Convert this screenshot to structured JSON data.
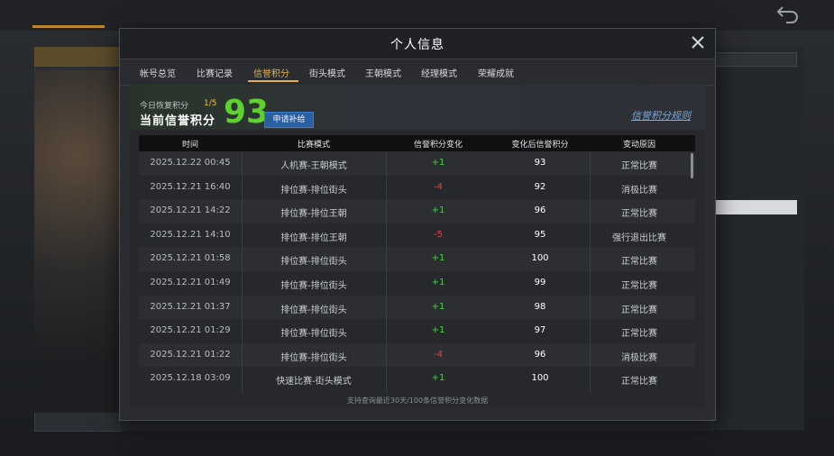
{
  "modal": {
    "title": "个人信息",
    "close_icon": "close-icon"
  },
  "tabs": [
    {
      "label": "帐号总览",
      "active": false
    },
    {
      "label": "比赛记录",
      "active": false
    },
    {
      "label": "信誉积分",
      "active": true
    },
    {
      "label": "街头模式",
      "active": false
    },
    {
      "label": "王朝模式",
      "active": false
    },
    {
      "label": "经理模式",
      "active": false
    },
    {
      "label": "荣耀成就",
      "active": false
    }
  ],
  "summary": {
    "today_label": "今日恢复积分",
    "today_value": "1/5",
    "current_label": "当前信誉积分",
    "score": "93",
    "apply_button": "申请补给",
    "rules_link": "信誉积分规则"
  },
  "table": {
    "headers": [
      "时间",
      "比赛模式",
      "信誉积分变化",
      "变化后信誉积分",
      "变动原因"
    ],
    "rows": [
      {
        "time": "2025.12.22  00:45",
        "mode": "人机赛-王朝模式",
        "change": "+1",
        "after": "93",
        "reason": "正常比赛"
      },
      {
        "time": "2025.12.21  16:40",
        "mode": "排位赛-排位街头",
        "change": "-4",
        "after": "92",
        "reason": "消极比赛"
      },
      {
        "time": "2025.12.21  14:22",
        "mode": "排位赛-排位王朝",
        "change": "+1",
        "after": "96",
        "reason": "正常比赛"
      },
      {
        "time": "2025.12.21  14:10",
        "mode": "排位赛-排位王朝",
        "change": "-5",
        "after": "95",
        "reason": "强行退出比赛"
      },
      {
        "time": "2025.12.21  01:58",
        "mode": "排位赛-排位街头",
        "change": "+1",
        "after": "100",
        "reason": "正常比赛"
      },
      {
        "time": "2025.12.21  01:49",
        "mode": "排位赛-排位街头",
        "change": "+1",
        "after": "99",
        "reason": "正常比赛"
      },
      {
        "time": "2025.12.21  01:37",
        "mode": "排位赛-排位街头",
        "change": "+1",
        "after": "98",
        "reason": "正常比赛"
      },
      {
        "time": "2025.12.21  01:29",
        "mode": "排位赛-排位街头",
        "change": "+1",
        "after": "97",
        "reason": "正常比赛"
      },
      {
        "time": "2025.12.21  01:22",
        "mode": "排位赛-排位街头",
        "change": "-4",
        "after": "96",
        "reason": "消极比赛"
      },
      {
        "time": "2025.12.18  03:09",
        "mode": "快速比赛-街头模式",
        "change": "+1",
        "after": "100",
        "reason": "正常比赛"
      }
    ]
  },
  "footer_note": "支持查询最近30天/100条信誉积分变化数据",
  "colors": {
    "accent": "#e2b24f",
    "score_green": "#5fd12f",
    "positive": "#49d049",
    "negative": "#e24444",
    "link_blue": "#79a8d9"
  }
}
